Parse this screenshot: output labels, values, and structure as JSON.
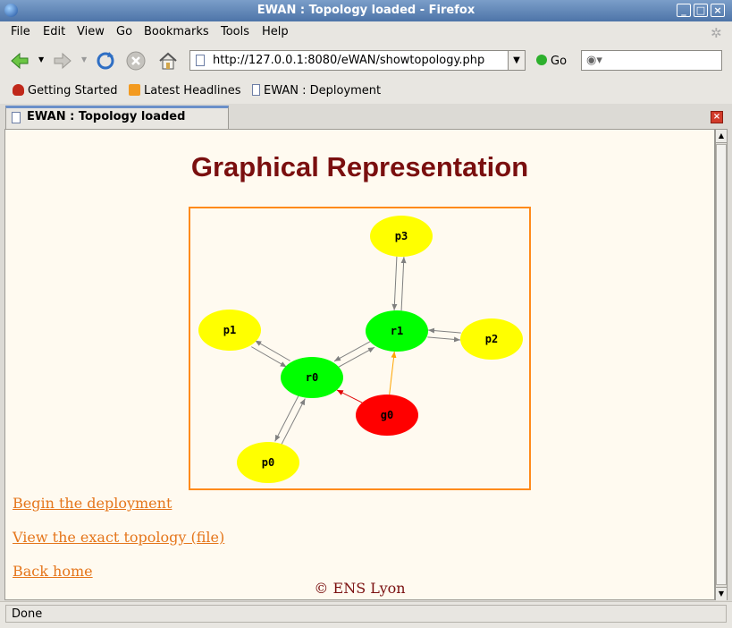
{
  "window": {
    "title": "EWAN : Topology loaded - Firefox"
  },
  "menu": {
    "items": [
      "File",
      "Edit",
      "View",
      "Go",
      "Bookmarks",
      "Tools",
      "Help"
    ]
  },
  "nav": {
    "url": "http://127.0.0.1:8080/eWAN/showtopology.php",
    "go_label": "Go"
  },
  "bookmarks": {
    "items": [
      "Getting Started",
      "Latest Headlines",
      "EWAN : Deployment"
    ]
  },
  "tab": {
    "label": "EWAN : Topology loaded"
  },
  "page": {
    "heading": "Graphical Representation",
    "links": [
      "Begin the deployment",
      "View the exact topology (file)",
      "Back home"
    ],
    "footer": "© ENS Lyon"
  },
  "graph": {
    "nodes": [
      {
        "id": "p3",
        "color": "#ffff00"
      },
      {
        "id": "r1",
        "color": "#00ff00"
      },
      {
        "id": "p1",
        "color": "#ffff00"
      },
      {
        "id": "p2",
        "color": "#ffff00"
      },
      {
        "id": "r0",
        "color": "#00ff00"
      },
      {
        "id": "g0",
        "color": "#ff0000"
      },
      {
        "id": "p0",
        "color": "#ffff00"
      }
    ],
    "edges": [
      {
        "from": "p3",
        "to": "r1",
        "color": "#808080"
      },
      {
        "from": "r1",
        "to": "p3",
        "color": "#808080"
      },
      {
        "from": "r1",
        "to": "p2",
        "color": "#808080"
      },
      {
        "from": "p2",
        "to": "r1",
        "color": "#808080"
      },
      {
        "from": "p1",
        "to": "r0",
        "color": "#808080"
      },
      {
        "from": "r0",
        "to": "p1",
        "color": "#808080"
      },
      {
        "from": "r0",
        "to": "r1",
        "color": "#808080"
      },
      {
        "from": "r1",
        "to": "r0",
        "color": "#808080"
      },
      {
        "from": "r0",
        "to": "p0",
        "color": "#808080"
      },
      {
        "from": "p0",
        "to": "r0",
        "color": "#808080"
      },
      {
        "from": "g0",
        "to": "r0",
        "color": "#e00000"
      },
      {
        "from": "g0",
        "to": "r1",
        "color": "#ffa500"
      }
    ]
  },
  "status": {
    "text": "Done"
  }
}
